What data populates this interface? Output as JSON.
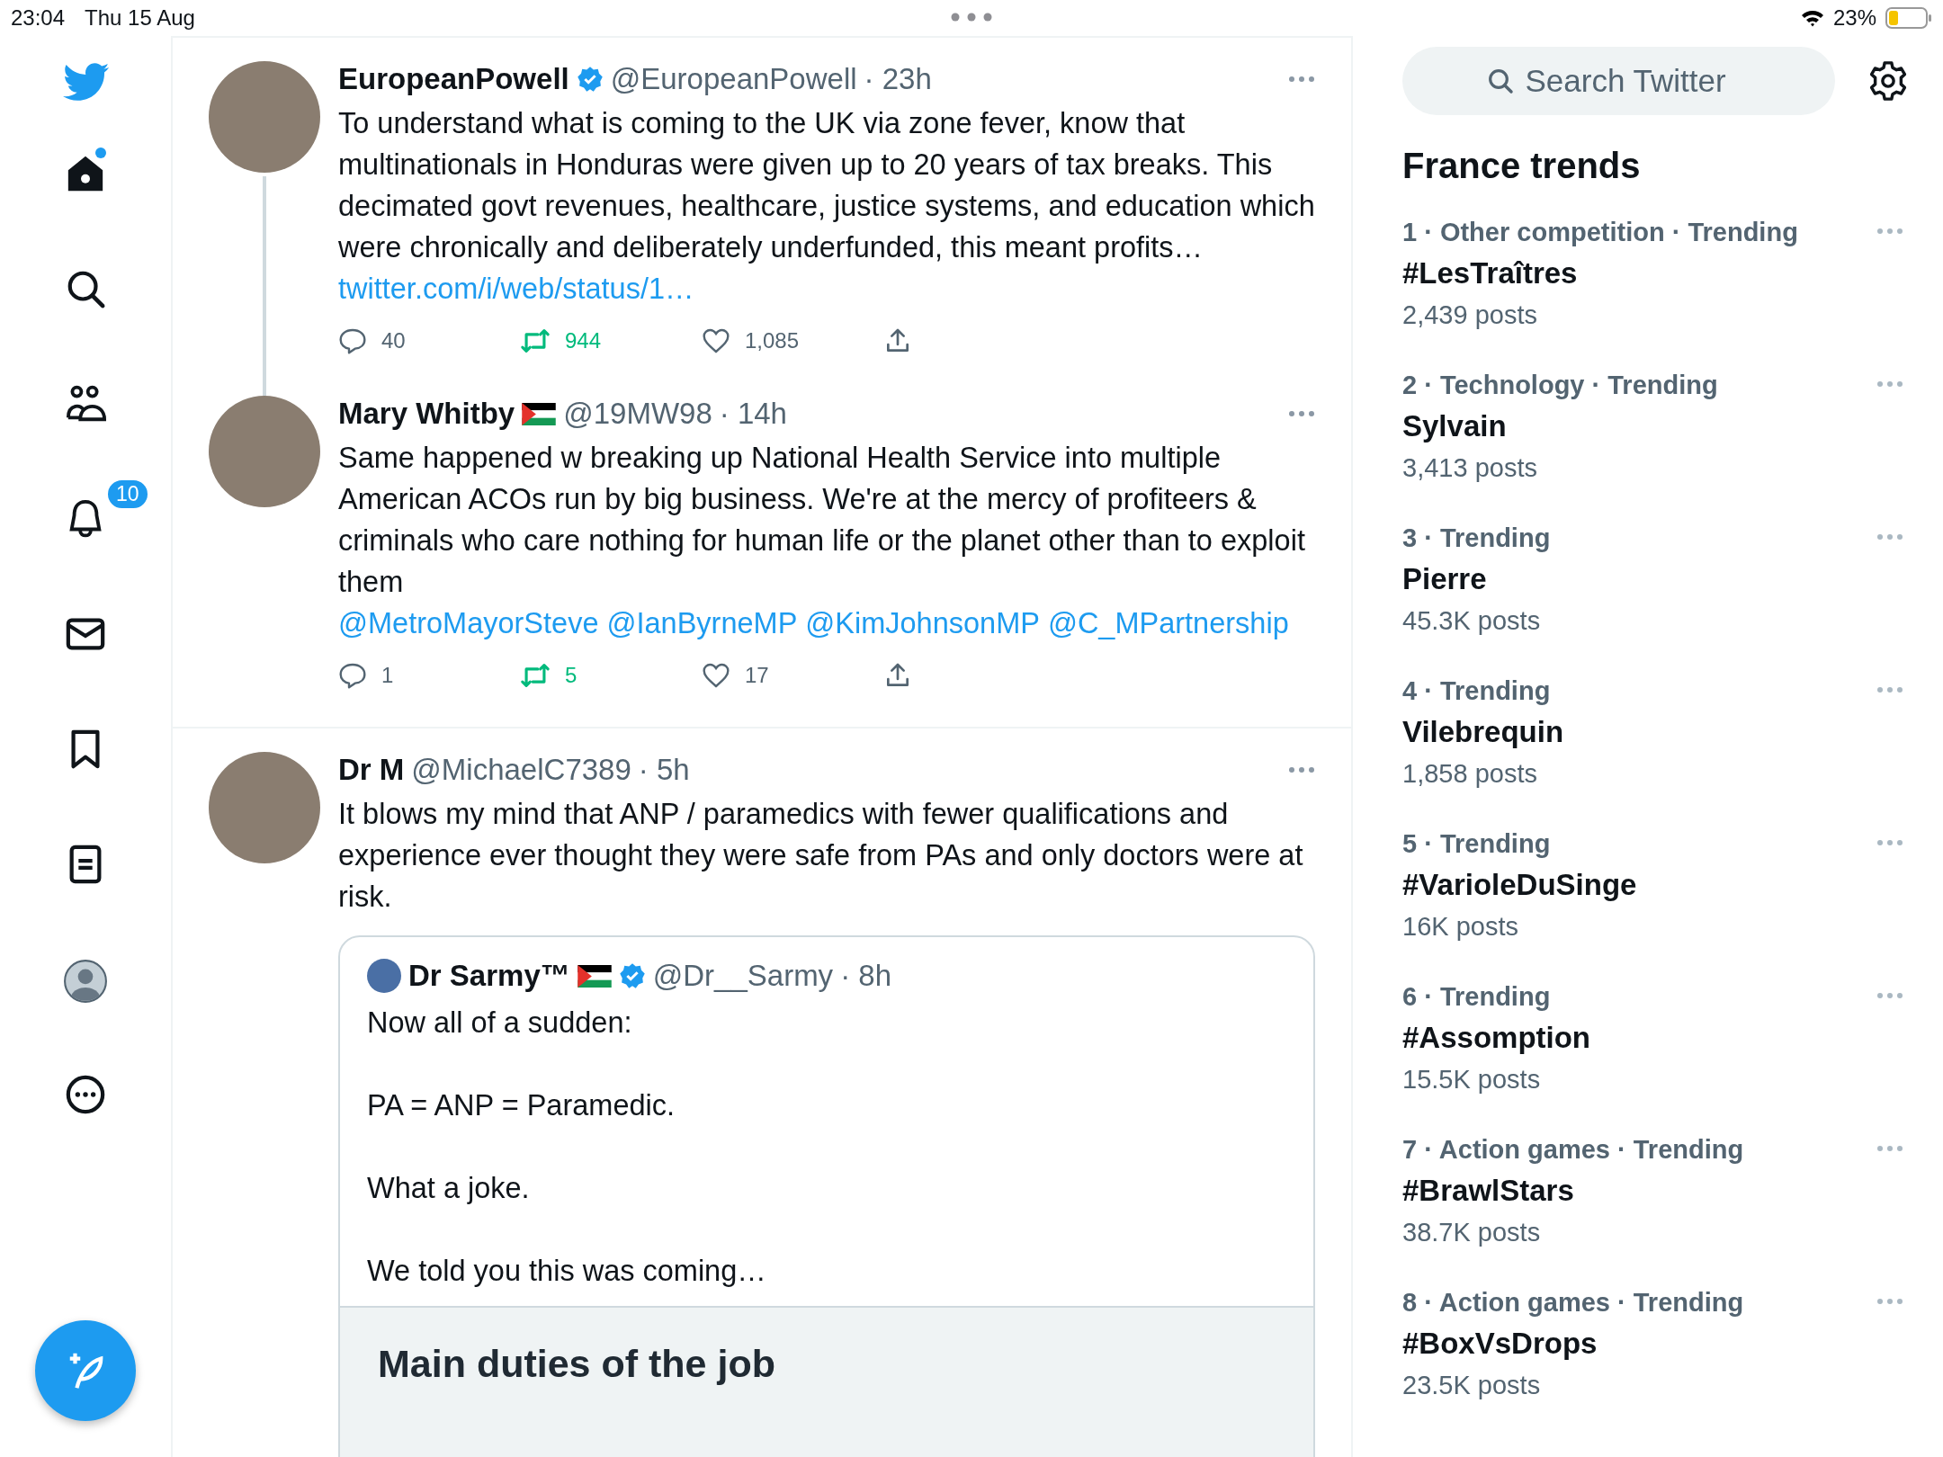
{
  "status_bar": {
    "time": "23:04",
    "date": "Thu 15 Aug",
    "battery": "23%"
  },
  "sidebar": {
    "nav": [
      {
        "kind": "home",
        "unread": true
      },
      {
        "kind": "search",
        "unread": false
      },
      {
        "kind": "people",
        "unread": false
      },
      {
        "kind": "notifications",
        "unread": false,
        "badge": "10"
      },
      {
        "kind": "messages",
        "unread": false
      },
      {
        "kind": "bookmarks",
        "unread": false
      },
      {
        "kind": "lists",
        "unread": false
      },
      {
        "kind": "profile",
        "unread": false
      },
      {
        "kind": "more",
        "unread": false
      }
    ]
  },
  "tweets": [
    {
      "name": "EuropeanPowell",
      "verified": true,
      "handle": "@EuropeanPowell",
      "time": "· 23h",
      "thread": true,
      "text": "To understand what is coming to the UK via zone fever, know that multinationals in Honduras were given up to 20 years of tax breaks. This decimated govt revenues, healthcare, justice systems, and education which were chronically and deliberately underfunded, this meant profits…",
      "link": "twitter.com/i/web/status/1…",
      "stats": {
        "replies": "40",
        "retweets": "944",
        "likes": "1,085",
        "retweeted": true
      }
    },
    {
      "name": "Mary Whitby",
      "flag": true,
      "handle": "@19MW98",
      "time": "· 14h",
      "text": "Same happened w breaking up National Health Service into multiple American ACOs run by big business. We're at the mercy of profiteers & criminals who care nothing for human life or the planet other than to exploit them",
      "mentions": [
        "@MetroMayorSteve",
        "@IanByrneMP",
        "@KimJohnsonMP",
        "@C_MPartnership"
      ],
      "stats": {
        "replies": "1",
        "retweets": "5",
        "likes": "17",
        "retweeted": true
      }
    },
    {
      "name": "Dr M",
      "handle": "@MichaelC7389",
      "time": "· 5h",
      "text": "It blows my mind that ANP / paramedics with fewer qualifications and experience ever thought they were safe from PAs and only doctors were at risk.",
      "quote": {
        "name": "Dr Sarmy™",
        "verified": true,
        "flag": true,
        "handle": "@Dr__Sarmy",
        "time": "· 8h",
        "paragraphs": [
          "Now all of a sudden:",
          "PA = ANP = Paramedic.",
          "What a joke.",
          "We told you this was coming…"
        ],
        "card_title": "Main duties of the job"
      }
    }
  ],
  "search": {
    "placeholder": "Search Twitter"
  },
  "trends": {
    "title": "France trends",
    "items": [
      {
        "meta": "1 · Other competition · Trending",
        "name": "#LesTraîtres",
        "posts": "2,439 posts"
      },
      {
        "meta": "2 · Technology · Trending",
        "name": "Sylvain",
        "posts": "3,413 posts"
      },
      {
        "meta": "3 · Trending",
        "name": "Pierre",
        "posts": "45.3K posts"
      },
      {
        "meta": "4 · Trending",
        "name": "Vilebrequin",
        "posts": "1,858 posts"
      },
      {
        "meta": "5 · Trending",
        "name": "#VarioleDuSinge",
        "posts": "16K posts"
      },
      {
        "meta": "6 · Trending",
        "name": "#Assomption",
        "posts": "15.5K posts"
      },
      {
        "meta": "7 · Action games · Trending",
        "name": "#BrawlStars",
        "posts": "38.7K posts"
      },
      {
        "meta": "8 · Action games · Trending",
        "name": "#BoxVsDrops",
        "posts": "23.5K posts"
      }
    ]
  }
}
